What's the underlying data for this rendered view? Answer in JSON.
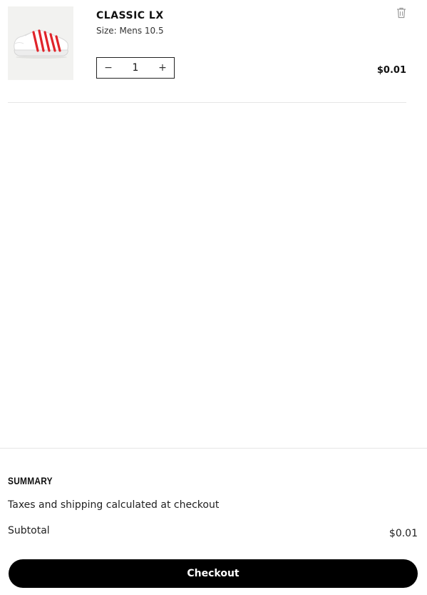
{
  "cart": {
    "items": [
      {
        "name": "CLASSIC LX",
        "size": "Size: Mens 10.5",
        "quantity": "1",
        "decrement_symbol": "−",
        "increment_symbol": "+",
        "price": "$0.01",
        "image": "white-sneaker-red-stripes"
      }
    ],
    "remove_icon": "trash-icon"
  },
  "summary": {
    "title": "SUMMARY",
    "note": "Taxes and shipping calculated at checkout",
    "subtotal_label": "Subtotal",
    "subtotal_value": "$0.01",
    "checkout_label": "Checkout"
  },
  "colors": {
    "accent": "#000000",
    "stripe": "#e0242a",
    "thumb_bg": "#f2f2f0"
  }
}
